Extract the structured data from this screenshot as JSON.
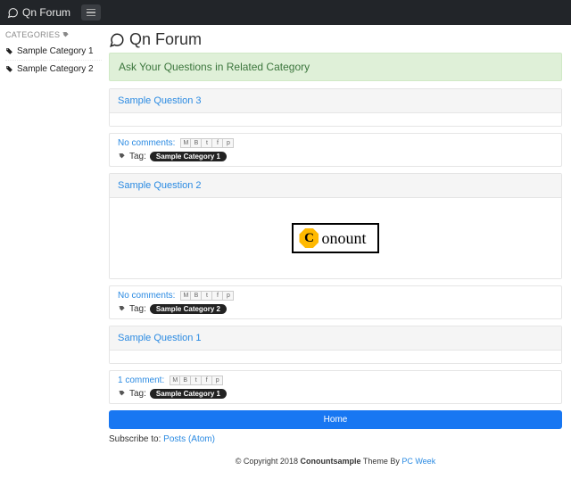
{
  "brand": "Qn Forum",
  "sidebar": {
    "header": "CATEGORIES",
    "items": [
      {
        "label": "Sample Category 1"
      },
      {
        "label": "Sample Category 2"
      }
    ]
  },
  "page_title": "Qn Forum",
  "banner": "Ask Your Questions in Related Category",
  "posts": [
    {
      "title": "Sample Question 3",
      "comments_text": "No comments:",
      "tag_label": "Tag:",
      "tag": "Sample Category 1",
      "has_image": false
    },
    {
      "title": "Sample Question 2",
      "comments_text": "No comments:",
      "tag_label": "Tag:",
      "tag": "Sample Category 2",
      "has_image": true,
      "image_text": "onount"
    },
    {
      "title": "Sample Question 1",
      "comments_text": "1 comment:",
      "tag_label": "Tag:",
      "tag": "Sample Category 1",
      "has_image": false
    }
  ],
  "home_button": "Home",
  "subscribe_prefix": "Subscribe to: ",
  "subscribe_link": "Posts (Atom)",
  "footer": {
    "prefix": "© Copyright 2018 ",
    "site": "Conountsample",
    "mid": " Theme By ",
    "by": "PC Week"
  }
}
